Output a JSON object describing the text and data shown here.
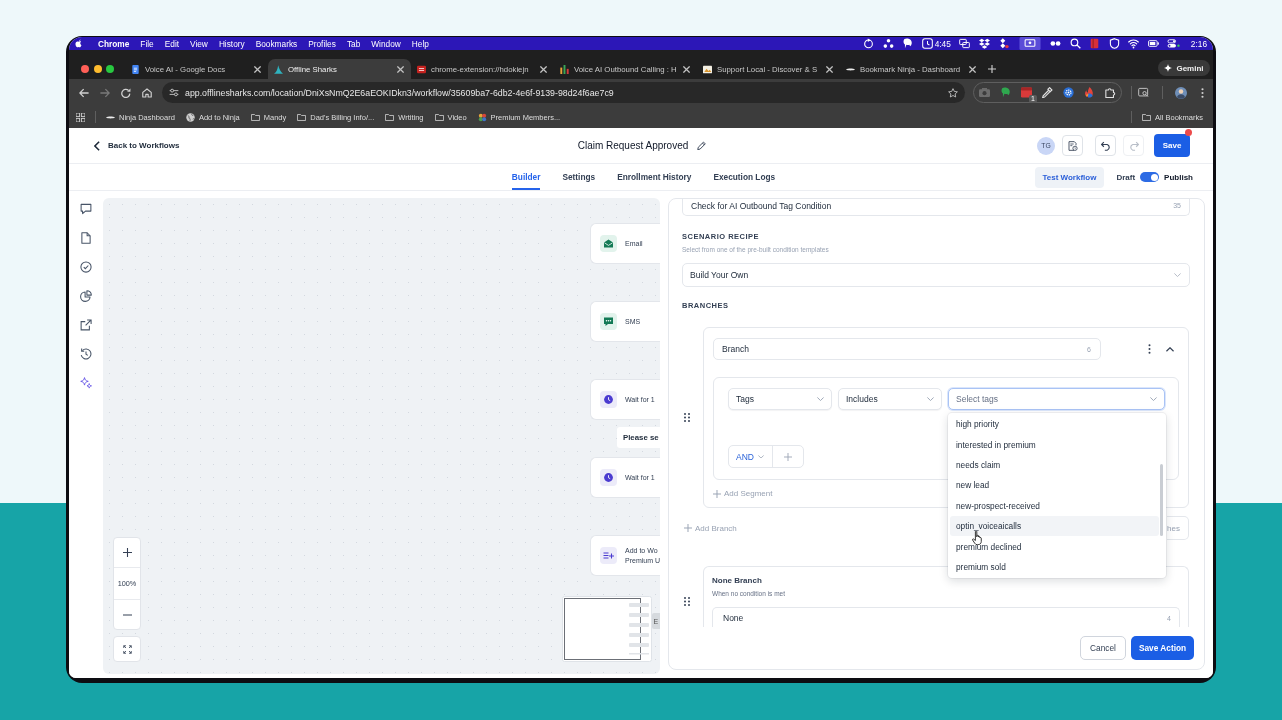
{
  "menu_bar": {
    "app": "Chrome",
    "menus": [
      "File",
      "Edit",
      "View",
      "History",
      "Bookmarks",
      "Profiles",
      "Tab",
      "Window",
      "Help"
    ],
    "timer": "4:45",
    "clock": "2:16"
  },
  "browser": {
    "tabs": [
      {
        "kind": "doc",
        "title": "Voice AI - Google Docs",
        "selected": false
      },
      {
        "kind": "shark",
        "title": "Offline Sharks",
        "selected": true
      },
      {
        "kind": "extension",
        "title": "chrome-extension://hdokiejn",
        "selected": false
      },
      {
        "kind": "bars",
        "title": "Voice AI Outbound Calling : H",
        "selected": false
      },
      {
        "kind": "thumbnail",
        "title": "Support Local - Discover & S",
        "selected": false
      },
      {
        "kind": "hat",
        "title": "Bookmark Ninja - Dashboard",
        "selected": false
      }
    ],
    "gemini": "Gemini",
    "url": "app.offlinesharks.com/location/DniXsNmQ2E6aEOKIDkn3/workflow/35609ba7-6db2-4e6f-9139-98d24f6ae7c9",
    "extension_badge": "1",
    "bookmarks": [
      {
        "kind": "hat",
        "label": "Ninja Dashboard"
      },
      {
        "kind": "globe",
        "label": "Add to Ninja"
      },
      {
        "kind": "folder",
        "label": "Mandy"
      },
      {
        "kind": "folder",
        "label": "Dad's Billing Info/..."
      },
      {
        "kind": "folder",
        "label": "Wrtiting"
      },
      {
        "kind": "folder",
        "label": "Video"
      },
      {
        "kind": "emblem",
        "label": "Premium Members..."
      }
    ],
    "all_bookmarks": "All Bookmarks"
  },
  "header": {
    "back": "Back to Workflows",
    "title": "Claim Request Approved",
    "avatar": "TG",
    "undo_disabled": false,
    "redo_disabled": true,
    "save": "Save",
    "unsaved": true
  },
  "tabs": [
    {
      "label": "Builder",
      "selected": true
    },
    {
      "label": "Settings",
      "selected": false
    },
    {
      "label": "Enrollment History",
      "selected": false
    },
    {
      "label": "Execution Logs",
      "selected": false
    }
  ],
  "test_workflow": "Test Workflow",
  "publish": {
    "off_label": "Draft",
    "on_label": "Publish",
    "on": true
  },
  "canvas": {
    "nodes": [
      {
        "kind": "email",
        "label": "Email"
      },
      {
        "kind": "sms",
        "label": "SMS"
      },
      {
        "kind": "wait",
        "label": "Wait for 1"
      },
      {
        "kind": "note",
        "label": "Please se"
      },
      {
        "kind": "wait",
        "label": "Wait for 1"
      },
      {
        "kind": "action",
        "label": "Add to Wo",
        "sublabel": "Premium U"
      }
    ],
    "zoom": "100%",
    "minimap_tab": "E"
  },
  "panel": {
    "name": {
      "value": "Check for AI Outbound Tag Condition",
      "count": "35"
    },
    "recipe": {
      "heading": "SCENARIO RECIPE",
      "hint": "Select from one of the pre-built condition templates",
      "value": "Build Your Own"
    },
    "branches_heading": "BRANCHES",
    "branches": [
      {
        "name": "Branch",
        "count": "6",
        "expanded": true,
        "segments": [
          {
            "field": "Tags",
            "operator": "Includes",
            "value": {
              "placeholder": "Select tags",
              "open": true,
              "options": [
                {
                  "label": "high priority",
                  "highlighted": false
                },
                {
                  "label": "interested in premium",
                  "highlighted": false
                },
                {
                  "label": "needs claim",
                  "highlighted": false
                },
                {
                  "label": "new lead",
                  "highlighted": false
                },
                {
                  "label": "new-prospect-received",
                  "highlighted": false
                },
                {
                  "label": "optin_voiceaicalls",
                  "highlighted": true
                },
                {
                  "label": "premium declined",
                  "highlighted": false
                },
                {
                  "label": "premium sold",
                  "highlighted": false
                }
              ]
            }
          }
        ],
        "join": "AND",
        "add_segment": "Add Segment"
      }
    ],
    "add_branch": "Add Branch",
    "side_button": "hes",
    "none_branch": {
      "title": "None Branch",
      "hint": "When no condition is met",
      "value": "None",
      "count": "4"
    },
    "cancel": "Cancel",
    "save": "Save Action"
  }
}
